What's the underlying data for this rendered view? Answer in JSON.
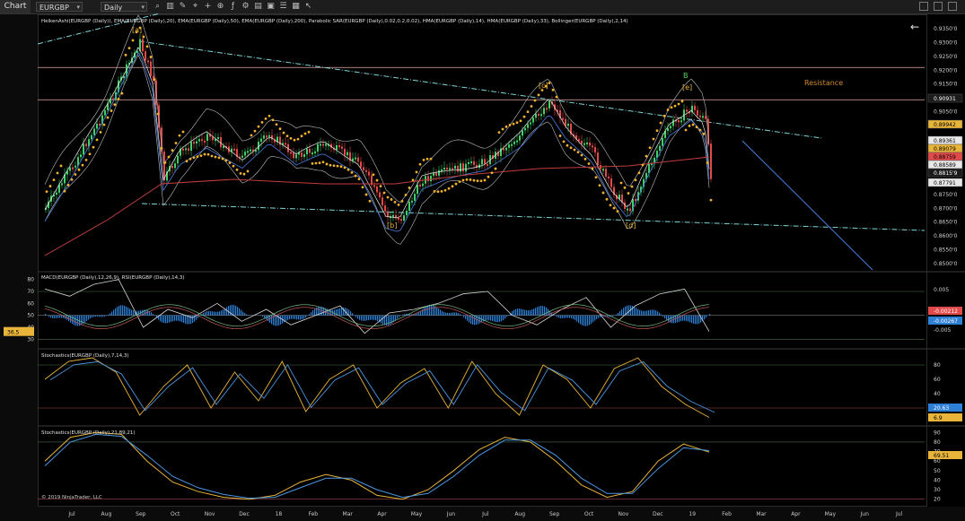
{
  "toolbar": {
    "tab_label": "Chart",
    "symbol": "EURGBP",
    "period": "Daily",
    "icons": [
      "search-icon",
      "bar-type-icon",
      "drawing-icon",
      "crosshair-icon",
      "plus-icon",
      "zoom-icon",
      "indicator-icon",
      "strategy-icon",
      "template-icon",
      "screenshot-icon",
      "properties-icon",
      "data-box-icon",
      "cursor-icon"
    ]
  },
  "colors": {
    "background": "#000000",
    "bull_candle": "#3fd06a",
    "bear_candle": "#e24a4a",
    "parabolic_sar": "#f0b22c",
    "ema20": "#e8e8e8",
    "ema200": "#c33d3d",
    "hma": "#4a7ddc",
    "macd_hist": "#2e7fd6",
    "stoch_k": "#e8b43a",
    "stoch_d": "#4a95e0"
  },
  "chart_data": [
    {
      "type": "line",
      "panel": "price",
      "title": "HeikenAshi(EURGBP (Daily)), EMA(EURGBP (Daily),20), EMA(EURGBP (Daily),50), EMA(EURGBP (Daily),200), Parabolic SAR(EURGBP (Daily),0.02,0.2,0.02), HMA(EURGBP (Daily),14), HMA(EURGBP (Daily),33), Bollinger(EURGBP (Daily),2,14)",
      "x_labels": [
        "Jul",
        "Aug",
        "Sep",
        "Oct",
        "Nov",
        "Dec",
        "18",
        "Feb",
        "Mar",
        "Apr",
        "May",
        "Jun",
        "Jul",
        "Aug",
        "Sep",
        "Oct",
        "Nov",
        "Dec",
        "19",
        "Feb",
        "Mar",
        "Apr",
        "May",
        "Jun",
        "Jul"
      ],
      "y_ticks": [
        "0.9350'0",
        "0.9300'0",
        "0.9250'0",
        "0.9200'0",
        "0.9150'0",
        "0.9100'0",
        "0.9050'0",
        "0.9000'0",
        "0.8950'0",
        "0.8900'0",
        "0.8850'0",
        "0.8800'0",
        "0.8750'0",
        "0.8700'0",
        "0.8650'0",
        "0.8600'0",
        "0.8550'0",
        "0.8500'0"
      ],
      "ylim": [
        0.848,
        0.937
      ],
      "close": [
        {
          "x": "Jul",
          "y": 0.879
        },
        {
          "x": "Aug",
          "y": 0.905
        },
        {
          "x": "Sep",
          "y": 0.929
        },
        {
          "x": "Sep",
          "y": 0.915
        },
        {
          "x": "Oct",
          "y": 0.895
        },
        {
          "x": "Nov",
          "y": 0.887
        },
        {
          "x": "Dec",
          "y": 0.892
        },
        {
          "x": "18",
          "y": 0.888
        },
        {
          "x": "Feb",
          "y": 0.886
        },
        {
          "x": "Mar",
          "y": 0.882
        },
        {
          "x": "Apr",
          "y": 0.869
        },
        {
          "x": "May",
          "y": 0.88
        },
        {
          "x": "Jun",
          "y": 0.885
        },
        {
          "x": "Jul",
          "y": 0.89
        },
        {
          "x": "Aug",
          "y": 0.9
        },
        {
          "x": "Sep",
          "y": 0.908
        },
        {
          "x": "Oct",
          "y": 0.891
        },
        {
          "x": "Nov",
          "y": 0.872
        },
        {
          "x": "Dec",
          "y": 0.893
        },
        {
          "x": "19",
          "y": 0.9
        },
        {
          "x": "19",
          "y": 0.8815
        }
      ],
      "ema200": [
        {
          "x": "Jul",
          "y": 0.8545
        },
        {
          "x": "Sep",
          "y": 0.87
        },
        {
          "x": "Nov",
          "y": 0.879
        },
        {
          "x": "18",
          "y": 0.88
        },
        {
          "x": "Mar",
          "y": 0.879
        },
        {
          "x": "May",
          "y": 0.88
        },
        {
          "x": "Jul",
          "y": 0.881
        },
        {
          "x": "Sep",
          "y": 0.883
        },
        {
          "x": "Nov",
          "y": 0.884
        },
        {
          "x": "19",
          "y": 0.887
        }
      ],
      "horizontal_lines": [
        {
          "label": "0.92106",
          "y": 0.921,
          "color": "#e6a8a8"
        },
        {
          "label": "0.90931",
          "y": 0.9093,
          "color": "#e6a8a8"
        }
      ],
      "trendlines": [
        {
          "from": {
            "x": "Jul",
            "y": 0.928
          },
          "to": {
            "x": "Sep",
            "y": 0.942
          },
          "style": "dash-dot"
        },
        {
          "from": {
            "x": "Sep",
            "y": 0.9295
          },
          "to": {
            "x": "Dec",
            "y": 0.8968
          },
          "style": "dash-dot"
        },
        {
          "from": {
            "x": "Sep",
            "y": 0.871
          },
          "to": {
            "x": "Jul",
            "y": 0.8611
          },
          "style": "dash-dot"
        },
        {
          "from": {
            "x": "19",
            "y": 0.899
          },
          "to": {
            "x": "Mar",
            "y": 0.848
          },
          "style": "solid",
          "color": "#4a7ddc"
        }
      ],
      "annotations": [
        {
          "text": "[a]",
          "x": "Sep",
          "y": 0.9325
        },
        {
          "text": "[b]",
          "x": "Apr",
          "y": 0.8615
        },
        {
          "text": "[c]",
          "x": "Aug",
          "y": 0.914
        },
        {
          "text": "[d]",
          "x": "Nov",
          "y": 0.862
        },
        {
          "text": "B",
          "x": "Dec",
          "y": 0.9175
        },
        {
          "text": "[e]",
          "x": "Dec",
          "y": 0.914
        },
        {
          "text": "Resistance",
          "x": "May",
          "y": 0.9148
        }
      ],
      "price_tags": [
        {
          "value": "0.90931",
          "bg": "#1a1a1a",
          "fg": "#ffffff"
        },
        {
          "value": "0.89942",
          "bg": "#e8b43a",
          "fg": "#000000"
        },
        {
          "value": "0.89361",
          "bg": "#e8e8e8",
          "fg": "#000000"
        },
        {
          "value": "0.89079",
          "bg": "#e8b43a",
          "fg": "#000000"
        },
        {
          "value": "0.88759",
          "bg": "#e24a4a",
          "fg": "#000000"
        },
        {
          "value": "0.88589",
          "bg": "#e8e8e8",
          "fg": "#000000"
        },
        {
          "value": "0.8815'9",
          "bg": "#1a1a1a",
          "fg": "#ffffff"
        },
        {
          "value": "0.87791",
          "bg": "#e8e8e8",
          "fg": "#000000"
        }
      ]
    },
    {
      "type": "line",
      "panel": "macd_rsi",
      "title": "MACD(EURGBP (Daily),12,26,9), RSI(EURGBP (Daily),14,3)",
      "left_ticks": [
        "80",
        "70",
        "60",
        "50",
        "40",
        "30"
      ],
      "right_ticks": [
        "0.005",
        "-0.005"
      ],
      "rsi_last": "36.5",
      "macd_tags": [
        "-0.00212",
        "-0.00267"
      ],
      "rsi": [
        72,
        66,
        76,
        80,
        40,
        55,
        48,
        60,
        45,
        55,
        42,
        50,
        58,
        35,
        52,
        55,
        60,
        68,
        70,
        50,
        42,
        55,
        65,
        40,
        58,
        68,
        72,
        36.5
      ]
    },
    {
      "type": "line",
      "panel": "stoch_fast",
      "title": "Stochastics(EURGBP (Daily),7,14,3)",
      "right_ticks": [
        "80",
        "60",
        "40",
        "20"
      ],
      "last_values": [
        "20.63",
        "6.9"
      ],
      "k": [
        60,
        85,
        90,
        70,
        10,
        50,
        80,
        20,
        70,
        30,
        85,
        15,
        60,
        80,
        20,
        55,
        75,
        20,
        85,
        40,
        10,
        80,
        60,
        20,
        75,
        90,
        50,
        25,
        6.9
      ]
    },
    {
      "type": "line",
      "panel": "stoch_slow",
      "title": "Stochastics(EURGBP (Daily),21,89,21)",
      "right_ticks": [
        "90",
        "80",
        "70",
        "60",
        "50",
        "40",
        "30",
        "20"
      ],
      "last_value": "69.51",
      "k": [
        60,
        85,
        90,
        88,
        60,
        38,
        28,
        22,
        20,
        24,
        38,
        46,
        40,
        24,
        20,
        30,
        50,
        72,
        85,
        80,
        60,
        35,
        22,
        28,
        60,
        78,
        69.51
      ],
      "d": [
        55,
        80,
        88,
        86,
        66,
        44,
        32,
        25,
        21,
        22,
        32,
        42,
        42,
        30,
        22,
        26,
        44,
        66,
        82,
        82,
        66,
        42,
        26,
        26,
        52,
        74,
        71
      ]
    }
  ],
  "copyright": "© 2019 NinjaTrader, LLC"
}
